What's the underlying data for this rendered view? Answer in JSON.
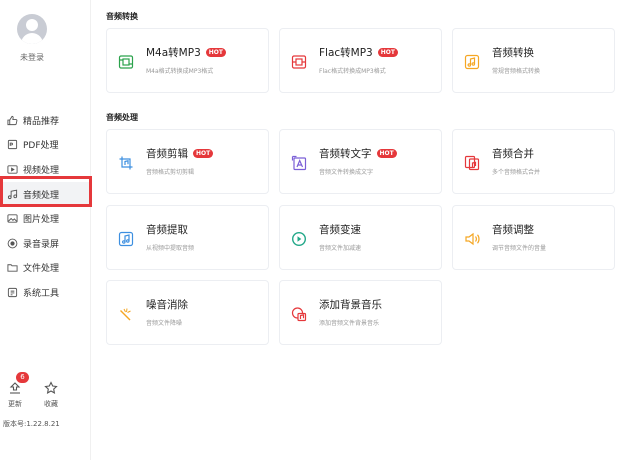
{
  "sidebar": {
    "login_text": "未登录",
    "items": [
      {
        "label": "精品推荐",
        "icon": "thumbs-up-icon"
      },
      {
        "label": "PDF处理",
        "icon": "pdf-icon"
      },
      {
        "label": "视频处理",
        "icon": "video-icon"
      },
      {
        "label": "音频处理",
        "icon": "music-note-icon",
        "active": true
      },
      {
        "label": "图片处理",
        "icon": "image-icon"
      },
      {
        "label": "录音录屏",
        "icon": "record-icon"
      },
      {
        "label": "文件处理",
        "icon": "folder-icon"
      },
      {
        "label": "系统工具",
        "icon": "toolbox-icon"
      }
    ],
    "update_label": "更新",
    "update_badge": "6",
    "favorite_label": "收藏",
    "version": "版本号:1.22.8.21"
  },
  "sections": [
    {
      "title": "音频转换",
      "cards": [
        {
          "title": "M4a转MP3",
          "desc": "M4a格式转换成MP3格式",
          "hot": "HOT",
          "icon": "m4a-convert-icon",
          "color": "#2ba24c"
        },
        {
          "title": "Flac转MP3",
          "desc": "Flac格式转换成MP3格式",
          "hot": "HOT",
          "icon": "flac-convert-icon",
          "color": "#e5383b"
        },
        {
          "title": "音频转换",
          "desc": "常规音频格式转换",
          "hot": "",
          "icon": "audio-convert-icon",
          "color": "#f5a623"
        }
      ]
    },
    {
      "title": "音频处理",
      "cards": [
        {
          "title": "音频剪辑",
          "desc": "音频格式剪切剪辑",
          "hot": "HOT",
          "icon": "audio-cut-icon",
          "color": "#3d8fe0"
        },
        {
          "title": "音频转文字",
          "desc": "音频文件转换成文字",
          "hot": "HOT",
          "icon": "audio-to-text-icon",
          "color": "#7b5fd6"
        },
        {
          "title": "音频合并",
          "desc": "多个音频格式合并",
          "hot": "",
          "icon": "audio-merge-icon",
          "color": "#e5383b"
        },
        {
          "title": "音频提取",
          "desc": "从视频中提取音频",
          "hot": "",
          "icon": "audio-extract-icon",
          "color": "#3d8fe0"
        },
        {
          "title": "音频变速",
          "desc": "音频文件加减速",
          "hot": "",
          "icon": "audio-speed-icon",
          "color": "#23a889"
        },
        {
          "title": "音频调整",
          "desc": "调节音频文件的音量",
          "hot": "",
          "icon": "volume-adjust-icon",
          "color": "#f5a623"
        },
        {
          "title": "噪音消除",
          "desc": "音频文件降噪",
          "hot": "",
          "icon": "noise-removal-icon",
          "color": "#f5a623"
        },
        {
          "title": "添加背景音乐",
          "desc": "添加音频文件背景音乐",
          "hot": "",
          "icon": "add-bgm-icon",
          "color": "#e5383b"
        }
      ]
    }
  ]
}
